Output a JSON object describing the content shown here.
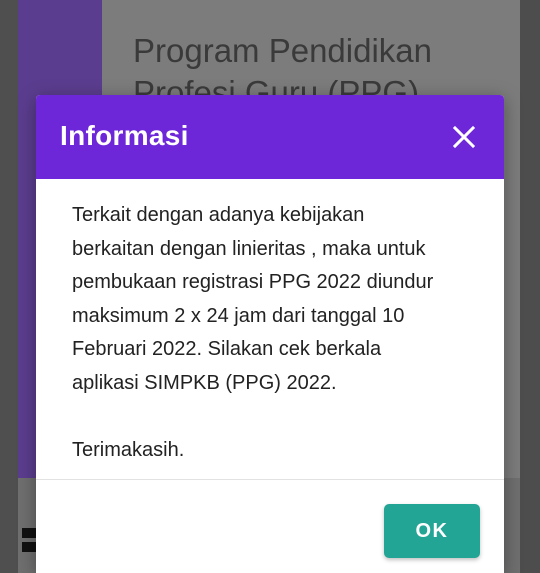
{
  "background": {
    "title": "Program Pendidikan Profesi Guru (PPG)"
  },
  "dialog": {
    "title": "Informasi",
    "close_icon": "close-icon",
    "body_lines": [
      "Terkait dengan adanya kebijakan",
      "berkaitan dengan linieritas , maka untuk",
      "pembukaan registrasi PPG 2022 diundur",
      "maksimum 2 x 24 jam dari tanggal 10",
      "Februari 2022. Silakan cek berkala",
      "aplikasi SIMPKB (PPG) 2022."
    ],
    "closing": "Terimakasih.",
    "ok_label": "OK"
  },
  "colors": {
    "header": "#6d27d9",
    "ok_button": "#23a596",
    "accent_bar": "#5b3d8f"
  }
}
